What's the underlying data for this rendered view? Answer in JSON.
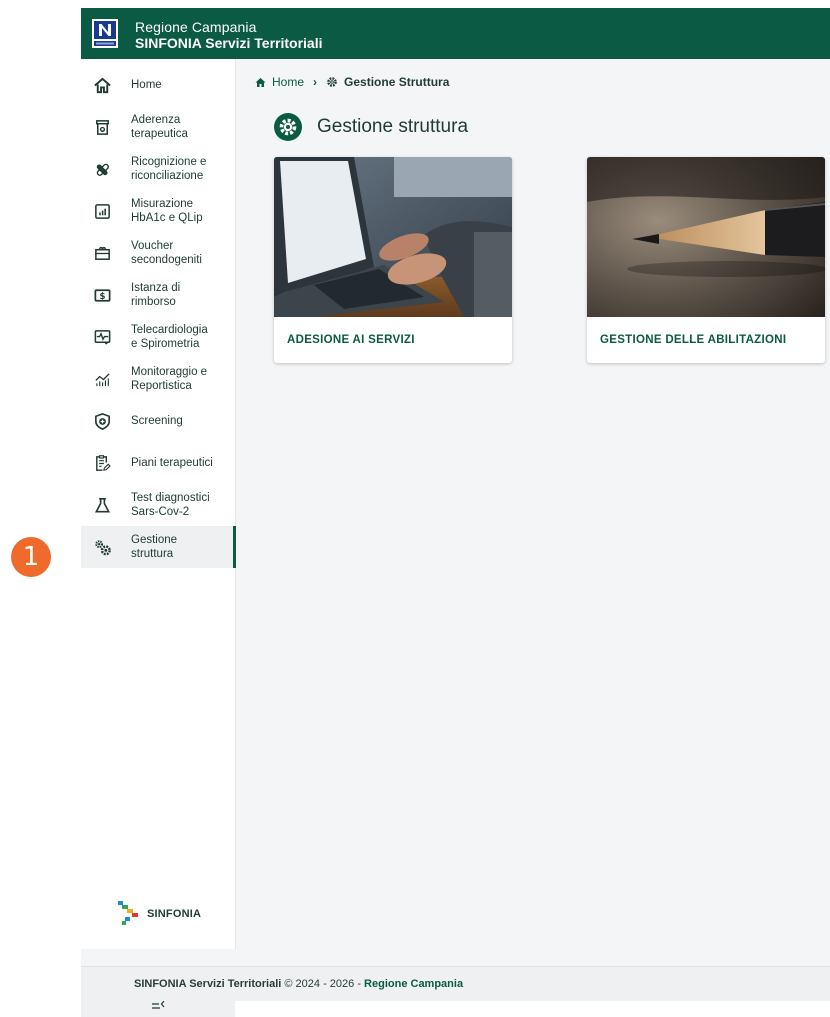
{
  "header": {
    "line1": "Regione Campania",
    "line2": "SINFONIA Servizi Territoriali"
  },
  "sidebar": {
    "items": [
      {
        "label": "Home",
        "icon": "home-icon"
      },
      {
        "label": "Aderenza\nterapeutica",
        "icon": "pill-box-icon"
      },
      {
        "label": "Ricognizione e\nriconciliazione",
        "icon": "pills-icon"
      },
      {
        "label": "Misurazione\nHbA1c e QLip",
        "icon": "chart-box-icon"
      },
      {
        "label": "Voucher\nsecondogeniti",
        "icon": "voucher-icon"
      },
      {
        "label": "Istanza di\nrimborso",
        "icon": "money-icon"
      },
      {
        "label": "Telecardiologia\ne Spirometria",
        "icon": "heart-monitor-icon"
      },
      {
        "label": "Monitoraggio e\nReportistica",
        "icon": "stats-icon"
      },
      {
        "label": "Screening",
        "icon": "shield-plus-icon"
      },
      {
        "label": "Piani terapeutici",
        "icon": "document-edit-icon"
      },
      {
        "label": "Test diagnostici\nSars-Cov-2",
        "icon": "flask-icon"
      },
      {
        "label": "Gestione\nstruttura",
        "icon": "gears-icon",
        "active": true
      }
    ],
    "brand": "SINFONIA"
  },
  "breadcrumb": {
    "home": "Home",
    "current": "Gestione Struttura"
  },
  "page": {
    "title": "Gestione struttura"
  },
  "cards": [
    {
      "title": "ADESIONE AI SERVIZI",
      "image": "laptop-typing-photo"
    },
    {
      "title": "GESTIONE DELLE ABILITAZIONI",
      "image": "pencil-photo"
    }
  ],
  "footer": {
    "app": "SINFONIA Servizi Territoriali",
    "copy": " © 2024 - 2026 - ",
    "region": "Regione Campania"
  },
  "callout": {
    "number": "1"
  },
  "colors": {
    "primary": "#0b5a44",
    "callout": "#f06a2b"
  }
}
